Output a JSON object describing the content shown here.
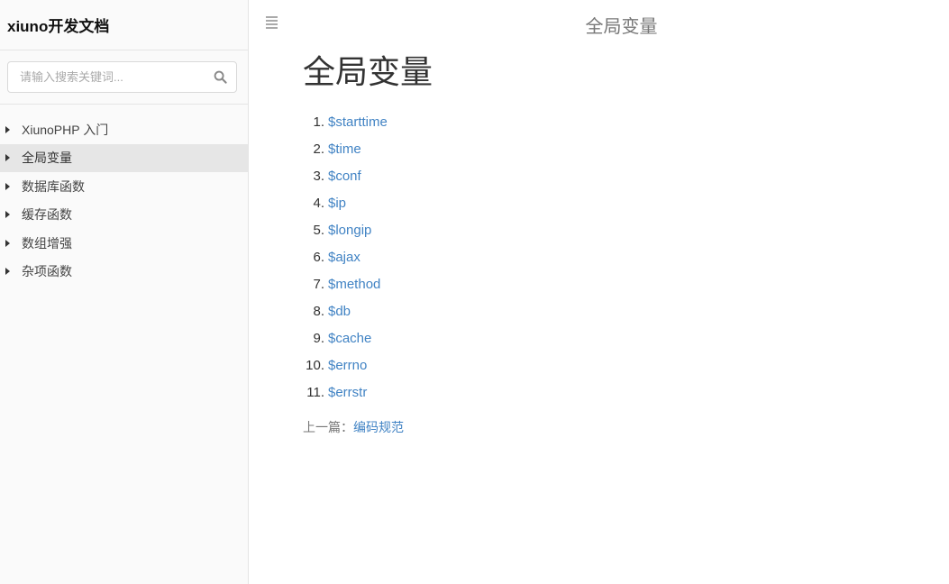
{
  "sidebar": {
    "title": "xiuno开发文档",
    "search": {
      "placeholder": "请输入搜索关键词...",
      "value": ""
    },
    "items": [
      {
        "label": "XiunoPHP 入门",
        "active": false
      },
      {
        "label": "全局变量",
        "active": true
      },
      {
        "label": "数据库函数",
        "active": false
      },
      {
        "label": "缓存函数",
        "active": false
      },
      {
        "label": "数组增强",
        "active": false
      },
      {
        "label": "杂项函数",
        "active": false
      }
    ]
  },
  "header": {
    "title": "全局变量"
  },
  "main": {
    "heading": "全局变量",
    "toc": [
      {
        "num": "1.",
        "label": "$starttime"
      },
      {
        "num": "2.",
        "label": "$time"
      },
      {
        "num": "3.",
        "label": "$conf"
      },
      {
        "num": "4.",
        "label": "$ip"
      },
      {
        "num": "5.",
        "label": "$longip"
      },
      {
        "num": "6.",
        "label": "$ajax"
      },
      {
        "num": "7.",
        "label": "$method"
      },
      {
        "num": "8.",
        "label": "$db"
      },
      {
        "num": "9.",
        "label": "$cache"
      },
      {
        "num": "10.",
        "label": "$errno"
      },
      {
        "num": "11.",
        "label": "$errstr"
      }
    ],
    "prev": {
      "label": "上一篇：",
      "link": "编码规范"
    }
  },
  "colors": {
    "link": "#4183c4",
    "active_bg": "#e6e6e6",
    "sidebar_bg": "#fafafa"
  },
  "icons": {
    "search": "search-icon",
    "menu": "menu-icon",
    "caret": "caret-right-icon"
  }
}
